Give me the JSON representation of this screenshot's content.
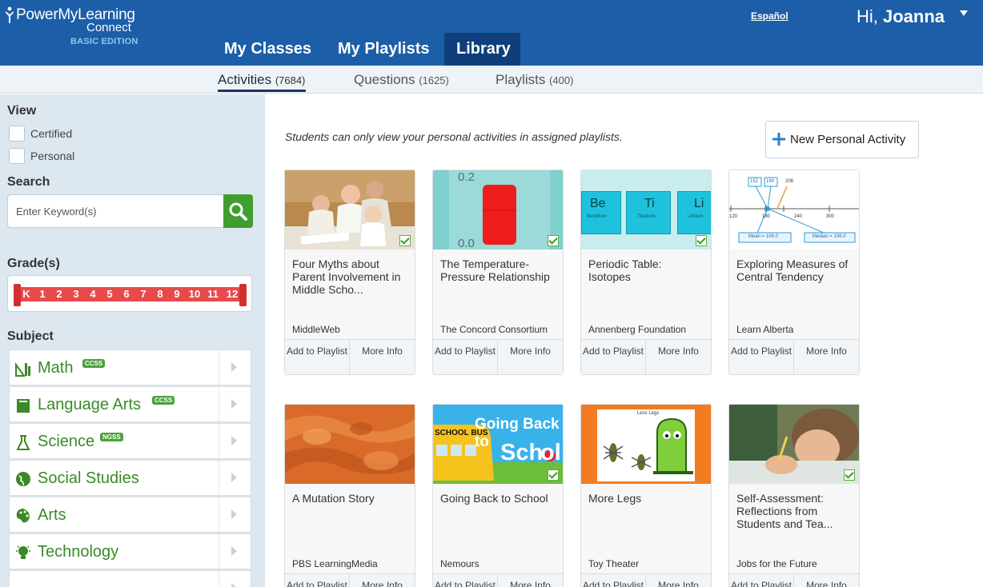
{
  "header": {
    "logo": {
      "line1": "PowerMyLearning",
      "line2": "Connect",
      "line3": "BASIC EDITION"
    },
    "language_link": "Español",
    "greeting_prefix": "Hi, ",
    "user_name": "Joanna",
    "nav": [
      {
        "label": "My Classes"
      },
      {
        "label": "My Playlists"
      },
      {
        "label": "Library",
        "active": true
      }
    ]
  },
  "subtabs": [
    {
      "label": "Activities",
      "count": "(7684)",
      "active": true
    },
    {
      "label": "Questions",
      "count": "(1625)"
    },
    {
      "label": "Playlists",
      "count": "(400)"
    }
  ],
  "sidebar": {
    "view_heading": "View",
    "view_options": [
      "Certified",
      "Personal"
    ],
    "search_heading": "Search",
    "search_placeholder": "Enter Keyword(s)",
    "grades_heading": "Grade(s)",
    "grades": [
      "K",
      "1",
      "2",
      "3",
      "4",
      "5",
      "6",
      "7",
      "8",
      "9",
      "10",
      "11",
      "12"
    ],
    "subject_heading": "Subject",
    "subjects": [
      {
        "label": "Math",
        "badge": "CCSS",
        "icon": "math-icon"
      },
      {
        "label": "Language Arts",
        "badge": "CCSS",
        "icon": "book-icon"
      },
      {
        "label": "Science",
        "badge": "NGSS",
        "icon": "beaker-icon"
      },
      {
        "label": "Social Studies",
        "badge": "",
        "icon": "globe-icon"
      },
      {
        "label": "Arts",
        "badge": "",
        "icon": "palette-icon"
      },
      {
        "label": "Technology",
        "badge": "",
        "icon": "lightbulb-icon"
      }
    ]
  },
  "main": {
    "notice": "Students can only view your personal activities in assigned playlists.",
    "new_activity_label": "New Personal Activity",
    "card_actions": {
      "add": "Add to Playlist",
      "more": "More Info"
    },
    "cards": [
      {
        "title": "Four Myths about Parent Involvement in Middle Scho...",
        "source": "MiddleWeb",
        "certified": true,
        "thumb": "family-photo"
      },
      {
        "title": "The Temperature-Pressure Relationship",
        "source": "The Concord Consortium",
        "certified": true,
        "thumb": "thermometer"
      },
      {
        "title": "Periodic Table: Isotopes",
        "source": "Annenberg Foundation",
        "certified": true,
        "thumb": "periodic-table"
      },
      {
        "title": "Exploring Measures of Central Tendency",
        "source": "Learn Alberta",
        "certified": false,
        "thumb": "number-line"
      },
      {
        "title": "A Mutation Story",
        "source": "PBS LearningMedia",
        "certified": false,
        "thumb": "cells"
      },
      {
        "title": "Going Back to School",
        "source": "Nemours",
        "certified": true,
        "thumb": "school-bus"
      },
      {
        "title": "More Legs",
        "source": "Toy Theater",
        "certified": false,
        "thumb": "monster"
      },
      {
        "title": "Self-Assessment: Reflections from Students and Tea...",
        "source": "Jobs for the Future",
        "certified": true,
        "thumb": "student-writing"
      }
    ],
    "thumb_text": {
      "temp_top": "0.2",
      "temp_bottom": "0.0",
      "elements": [
        {
          "symbol": "Be",
          "name": "Beryllium"
        },
        {
          "symbol": "Ti",
          "name": "Titanium"
        },
        {
          "symbol": "Li",
          "name": "Lithium"
        }
      ],
      "numberline_ticks": [
        "120",
        "180",
        "240",
        "300"
      ],
      "numberline_boxes": [
        "152",
        "190",
        "208"
      ],
      "mean_label": "Mean = 106.0",
      "median_label": "Median = 106.0",
      "school_line1": "Going Back to",
      "school_line2": "Sch",
      "school_line3": "ol",
      "school_bus": "SCHOOL BUS",
      "legs_title": "Less Legs"
    }
  }
}
